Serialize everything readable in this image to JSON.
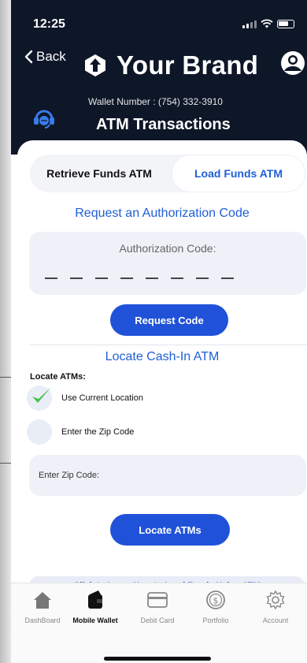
{
  "status_bar": {
    "time": "12:25"
  },
  "header": {
    "back_label": "Back",
    "brand_name": "Your Brand",
    "wallet_number": "Wallet Number : (754) 332-3910",
    "title": "ATM Transactions"
  },
  "tabs": {
    "retrieve_label": "Retrieve Funds ATM",
    "load_label": "Load Funds ATM",
    "active": "Load Funds ATM"
  },
  "authorization": {
    "section_title": "Request an Authorization Code",
    "field_label": "Authorization Code:",
    "code_length": 8,
    "request_button": "Request Code"
  },
  "locate": {
    "section_title": "Locate Cash-In ATM",
    "label": "Locate ATMs:",
    "options": [
      {
        "label": "Use Current Location",
        "checked": true
      },
      {
        "label": "Enter the Zip Code",
        "checked": false
      }
    ],
    "zip_placeholder": "Enter Zip Code:",
    "locate_button": "Locate ATMs"
  },
  "learn_link": "Click to Learn How to Load Funds Using ATM",
  "bottom_nav": [
    {
      "label": "DashBoard",
      "icon": "home-icon",
      "active": false
    },
    {
      "label": "Mobile Wallet",
      "icon": "wallet-icon",
      "active": true
    },
    {
      "label": "Debit Card",
      "icon": "card-icon",
      "active": false
    },
    {
      "label": "Portfolio",
      "icon": "dollar-coin-icon",
      "active": false
    },
    {
      "label": "Account",
      "icon": "gear-icon",
      "active": false
    }
  ],
  "colors": {
    "header_bg": "#0d1728",
    "accent_blue": "#1f52d8",
    "link_blue": "#1f5fd6",
    "check_green": "#45c14a"
  }
}
